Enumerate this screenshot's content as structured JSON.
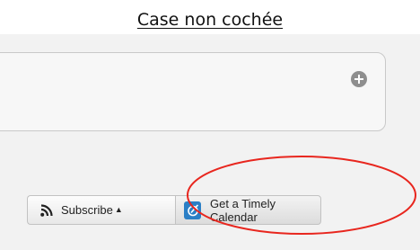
{
  "caption": "Case non cochée",
  "toolbar": {
    "subscribe_label": "Subscribe",
    "subscribe_caret": "▲",
    "timely_label": "Get a Timely Calendar"
  },
  "colors": {
    "highlight": "#e8261e",
    "timely_icon_bg": "#2b7fc6"
  },
  "icons": [
    "plus-circle-icon",
    "rss-icon",
    "timely-logo-icon"
  ]
}
